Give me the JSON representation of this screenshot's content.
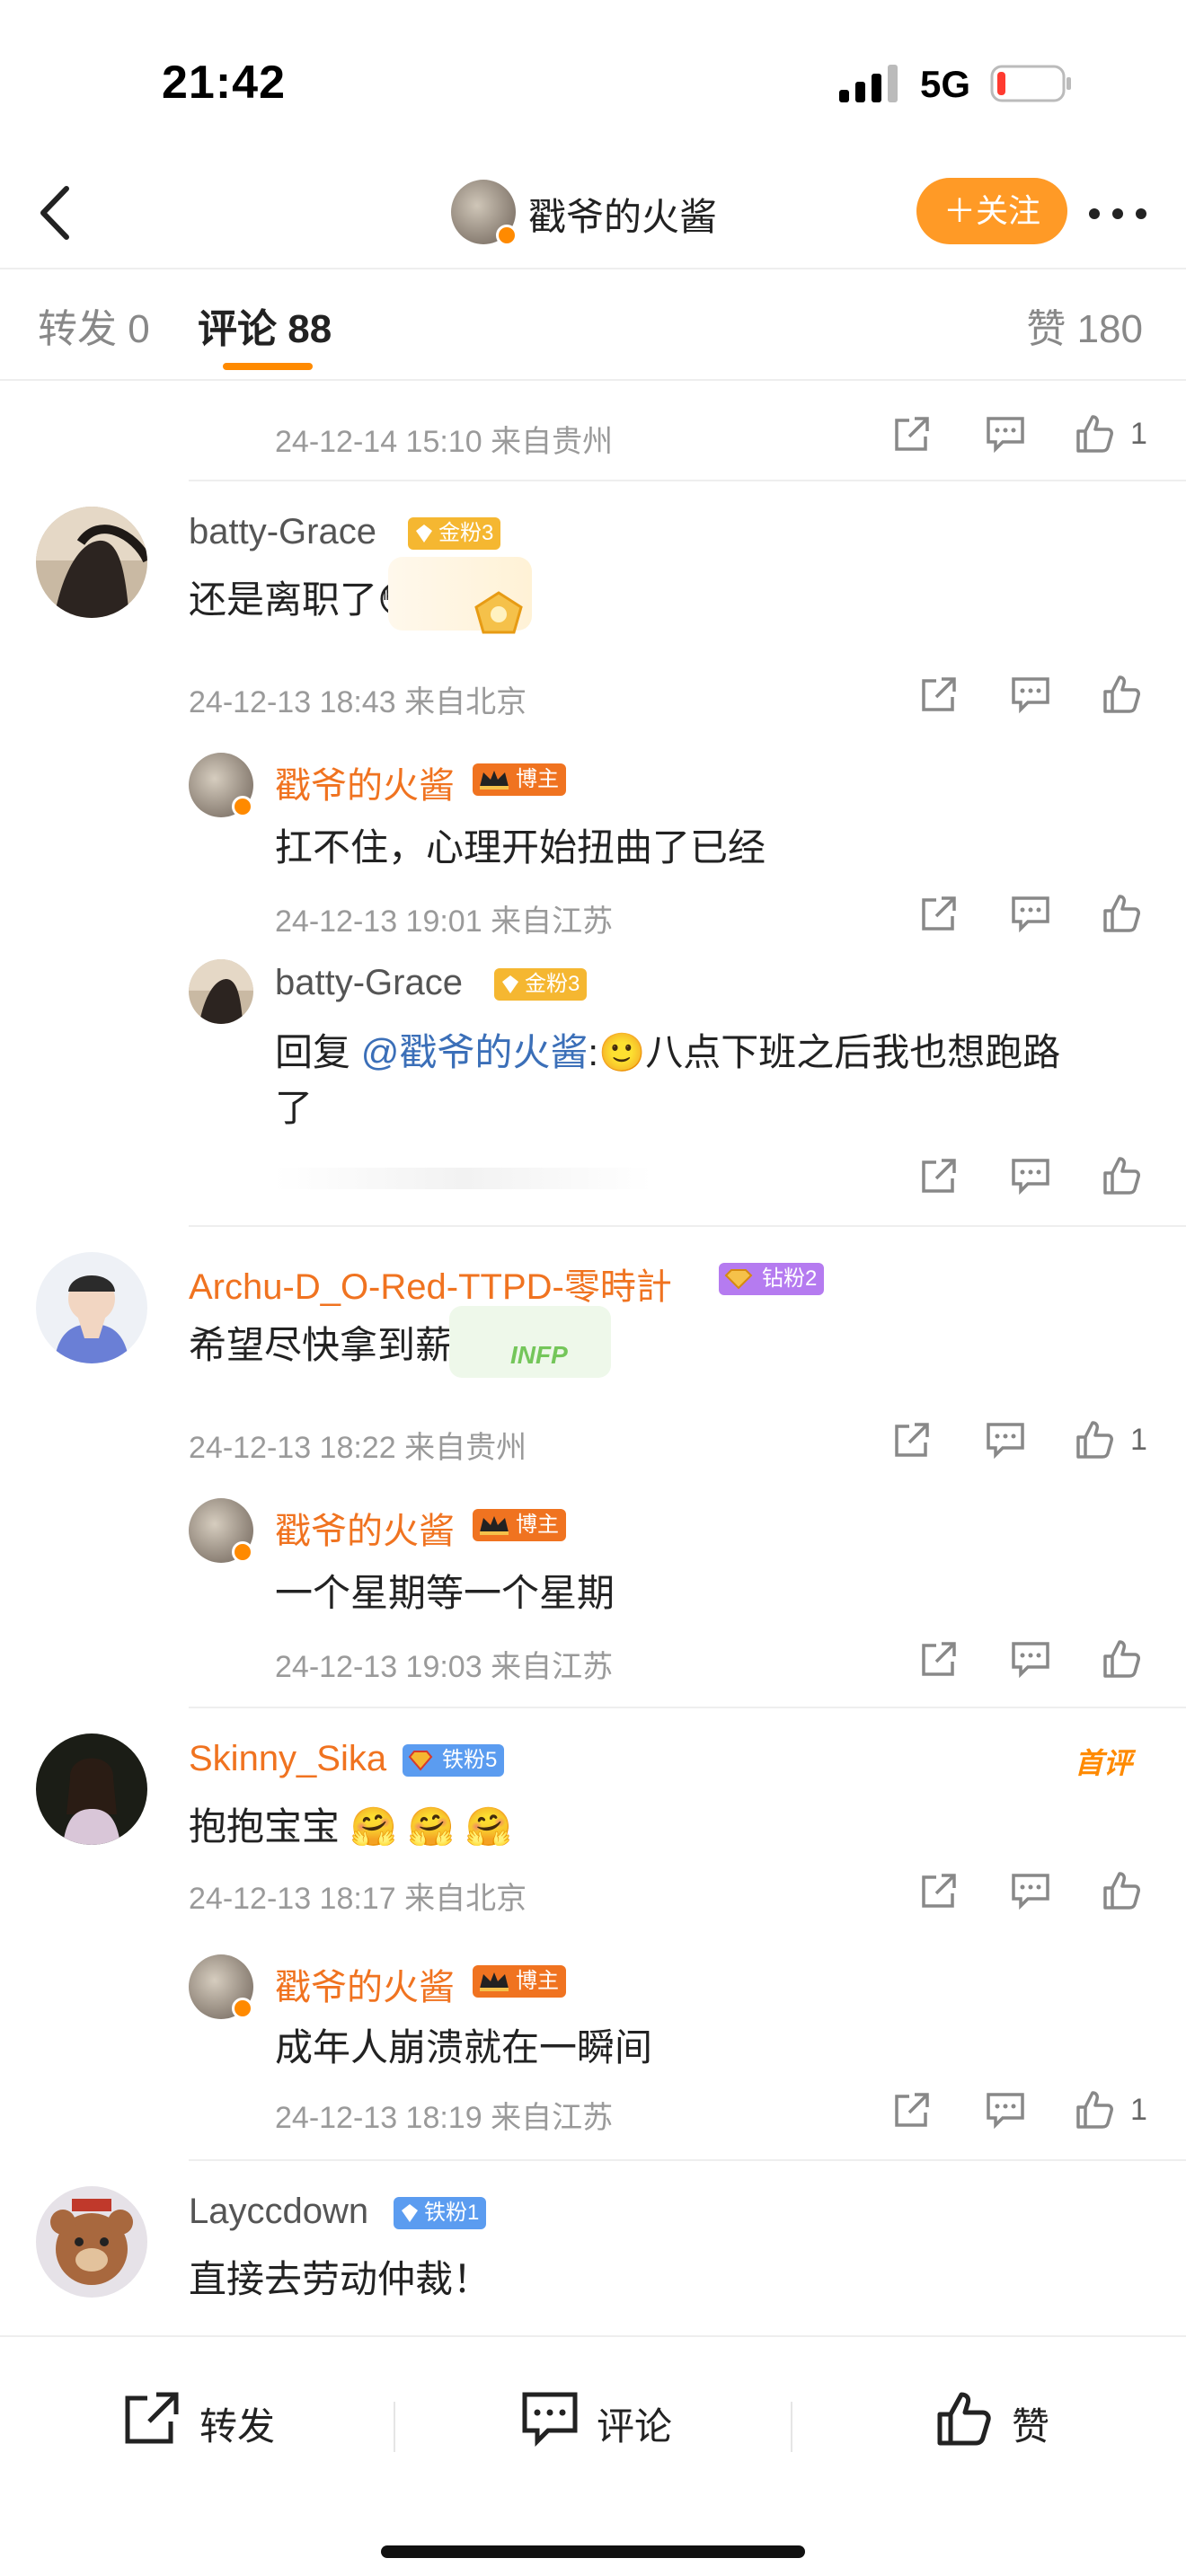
{
  "status": {
    "time": "21:42",
    "network": "5G"
  },
  "nav": {
    "title": "戳爷的火酱",
    "follow_label": "＋关注"
  },
  "tabs": {
    "forward": "转发 0",
    "comment": "评论 88",
    "like": "赞 180"
  },
  "comments": [
    {
      "meta": "24-12-14 15:10  来自贵州",
      "like_count": "1"
    },
    {
      "user": "batty-Grace",
      "badge": "金粉3",
      "text": "还是离职了😳",
      "meta": "24-12-13 18:43  来自北京",
      "replies": [
        {
          "user": "戳爷的火酱",
          "badge": "博主",
          "text": "扛不住，心理开始扭曲了已经",
          "meta": "24-12-13 19:01  来自江苏"
        },
        {
          "user": "batty-Grace",
          "badge": "金粉3",
          "reply_prefix": "回复",
          "mention": "@戳爷的火酱",
          "text_line1": ":🙂八点下班之后我也想跑路",
          "text_line2": "了"
        }
      ]
    },
    {
      "user": "Archu-D_O-Red-TTPD-零時計",
      "badge": "钻粉2",
      "text": "希望尽快拿到薪水",
      "meta": "24-12-13 18:22  来自贵州",
      "like_count": "1",
      "replies": [
        {
          "user": "戳爷的火酱",
          "badge": "博主",
          "text": "一个星期等一个星期",
          "meta": "24-12-13 19:03  来自江苏"
        }
      ]
    },
    {
      "user": "Skinny_Sika",
      "badge": "铁粉5",
      "tag": "首评",
      "text": "抱抱宝宝 🤗 🤗 🤗",
      "meta": "24-12-13 18:17  来自北京",
      "replies": [
        {
          "user": "戳爷的火酱",
          "badge": "博主",
          "text": "成年人崩溃就在一瞬间",
          "meta": "24-12-13 18:19  来自江苏",
          "like_count": "1"
        }
      ]
    },
    {
      "user": "Layccdown",
      "badge": "铁粉1",
      "text": "直接去劳动仲裁！"
    }
  ],
  "bottom_bar": {
    "forward": "转发",
    "comment": "评论",
    "like": "赞"
  },
  "colors": {
    "accent": "#ff8a00",
    "username_orange": "#f07320",
    "mention_blue": "#3b6fb8",
    "gold_badge": "#f5b731",
    "diamond_badge": "#b57bf0",
    "iron_badge": "#5b9cf0",
    "host_badge": "#f07320"
  },
  "icons": [
    "signal-icon",
    "battery-icon",
    "back-icon",
    "more-icon",
    "share-icon",
    "comment-icon",
    "like-icon"
  ]
}
